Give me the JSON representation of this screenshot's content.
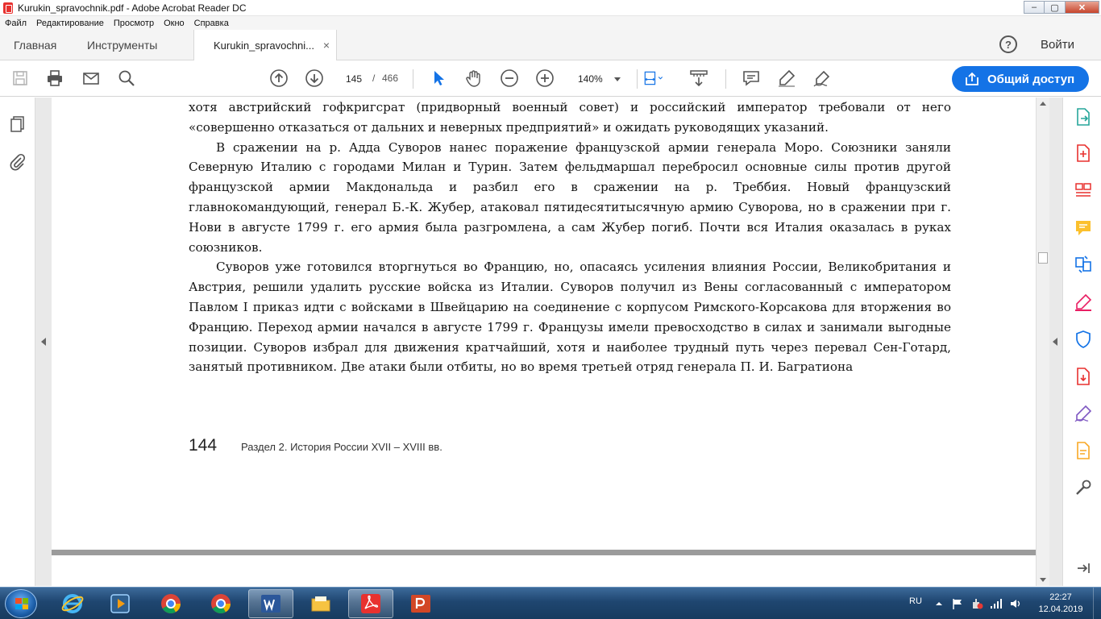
{
  "window": {
    "title": "Kurukin_spravochnik.pdf - Adobe Acrobat Reader DC",
    "minimize": "–",
    "maximize": "▢",
    "close": "✕"
  },
  "menu": [
    "Файл",
    "Редактирование",
    "Просмотр",
    "Окно",
    "Справка"
  ],
  "tabs": {
    "home": "Главная",
    "tools": "Инструменты",
    "document": "Kurukin_spravochni...",
    "close": "×",
    "help": "?",
    "signin": "Войти"
  },
  "toolbar": {
    "current_page": "145",
    "page_separator": "/",
    "total_pages": "466",
    "zoom": "140%",
    "share_label": "Общий доступ"
  },
  "document": {
    "paragraphs": [
      "хотя австрийский гофкригсрат (придворный военный совет) и российский император требовали от него «совершенно отказаться от дальних и неверных предприятий» и ожидать руководящих указаний.",
      "В сражении на р. Адда Суворов нанес поражение французской армии генерала Моро. Союзники заняли Северную Италию с городами Милан и Турин. Затем фельдмаршал перебросил основные силы против другой французской армии Макдональда и разбил его в сражении на р. Треббия. Новый французский главнокомандующий, генерал Б.-К. Жубер, атаковал пятидесятитысячную армию Суворова, но в сражении при г. Нови в августе 1799 г. его армия была разгромлена, а сам Жубер погиб. Почти вся Италия оказалась в руках союзников.",
      "Суворов уже готовился вторгнуться во Францию, но, опасаясь усиления влияния России, Великобритания и Австрия, решили удалить русские войска из Италии. Суворов получил из Вены согласованный с императором Павлом I приказ идти с войсками в Швейцарию на соединение с корпусом Римского-Корсакова для вторжения во Францию. Переход армии начался в августе 1799 г. Французы имели превосходство в силах и занимали выгодные позиции. Суворов избрал для движения кратчайший, хотя и наиболее трудный путь через перевал Сен-Готард, занятый противником. Две атаки были отбиты, но во время третьей отряд генерала П. И. Багратиона"
    ],
    "page_number": "144",
    "running_header": "Раздел 2. История России XVII – XVIII вв."
  },
  "taskbar": {
    "language": "RU",
    "time": "22:27",
    "date": "12.04.2019"
  },
  "colors": {
    "accent": "#1473e6",
    "acrobat_red": "#e8312f"
  }
}
